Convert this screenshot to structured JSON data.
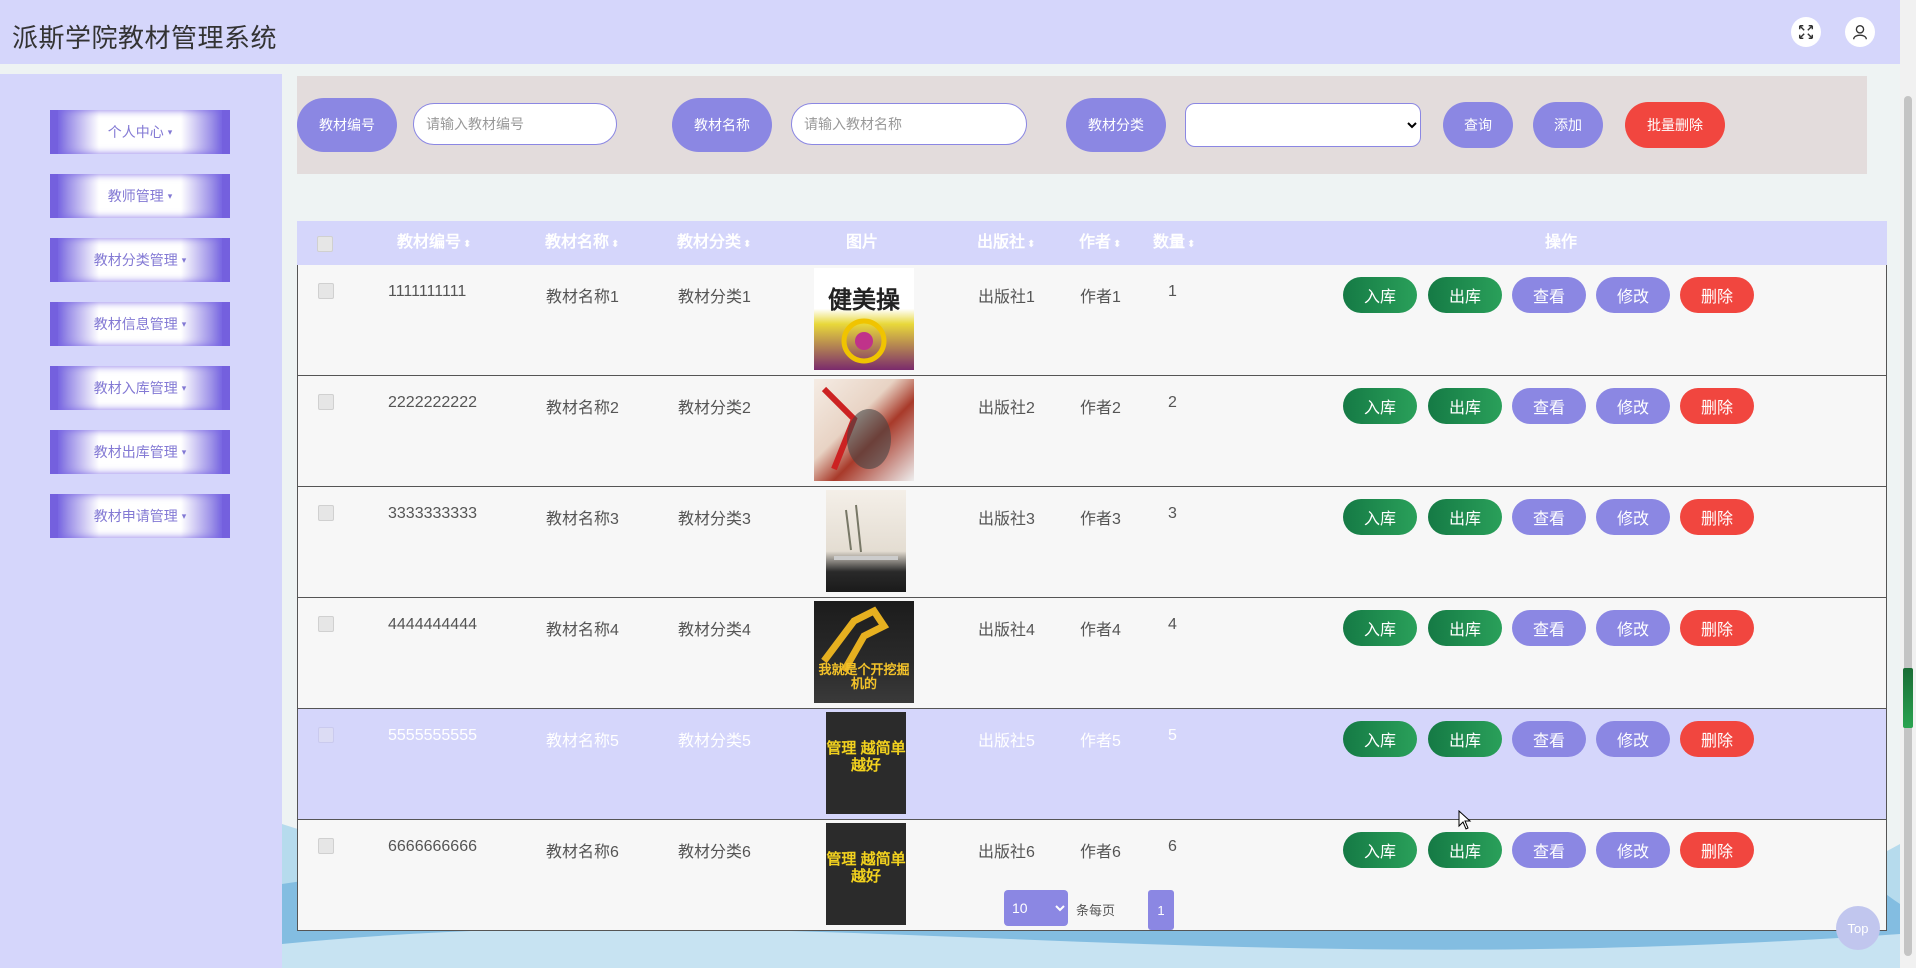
{
  "header": {
    "title": "派斯学院教材管理系统",
    "icons": [
      "fullscreen-icon",
      "user-icon"
    ]
  },
  "sidebar": {
    "items": [
      {
        "label": "个人中心"
      },
      {
        "label": "教师管理"
      },
      {
        "label": "教材分类管理"
      },
      {
        "label": "教材信息管理"
      },
      {
        "label": "教材入库管理"
      },
      {
        "label": "教材出库管理"
      },
      {
        "label": "教材申请管理"
      }
    ],
    "caret": "▾"
  },
  "search": {
    "code_label": "教材编号",
    "code_placeholder": "请输入教材编号",
    "name_label": "教材名称",
    "name_placeholder": "请输入教材名称",
    "category_label": "教材分类",
    "category_value": "",
    "query_button": "查询",
    "add_button": "添加",
    "batch_delete_button": "批量删除"
  },
  "table": {
    "columns": [
      "教材编号",
      "教材名称",
      "教材分类",
      "图片",
      "出版社",
      "作者",
      "数量",
      "操作"
    ],
    "sort_glyph": "⬍",
    "rows": [
      {
        "code": "1111111111",
        "name": "教材名称1",
        "category": "教材分类1",
        "cover": "健美操",
        "publisher": "出版社1",
        "author": "作者1",
        "qty": "1"
      },
      {
        "code": "2222222222",
        "name": "教材名称2",
        "category": "教材分类2",
        "cover": "",
        "publisher": "出版社2",
        "author": "作者2",
        "qty": "2"
      },
      {
        "code": "3333333333",
        "name": "教材名称3",
        "category": "教材分类3",
        "cover": "",
        "publisher": "出版社3",
        "author": "作者3",
        "qty": "3"
      },
      {
        "code": "4444444444",
        "name": "教材名称4",
        "category": "教材分类4",
        "cover": "我就是个开挖掘机的",
        "publisher": "出版社4",
        "author": "作者4",
        "qty": "4"
      },
      {
        "code": "5555555555",
        "name": "教材名称5",
        "category": "教材分类5",
        "cover": "管理 越简单越好",
        "publisher": "出版社5",
        "author": "作者5",
        "qty": "5"
      },
      {
        "code": "6666666666",
        "name": "教材名称6",
        "category": "教材分类6",
        "cover": "管理 越简单越好",
        "publisher": "出版社6",
        "author": "作者6",
        "qty": "6"
      }
    ],
    "actions": {
      "stock_in": "入库",
      "stock_out": "出库",
      "view": "查看",
      "edit": "修改",
      "delete": "删除"
    },
    "highlighted_row": 4
  },
  "pagination": {
    "page_size": "10",
    "unit": "条每页",
    "current_page": "1"
  },
  "back_to_top": "Top",
  "colors": {
    "accent": "#8b87e3",
    "header_bg": "#d5d6fb",
    "success_green": "#157a45",
    "danger_red": "#f1463f"
  }
}
